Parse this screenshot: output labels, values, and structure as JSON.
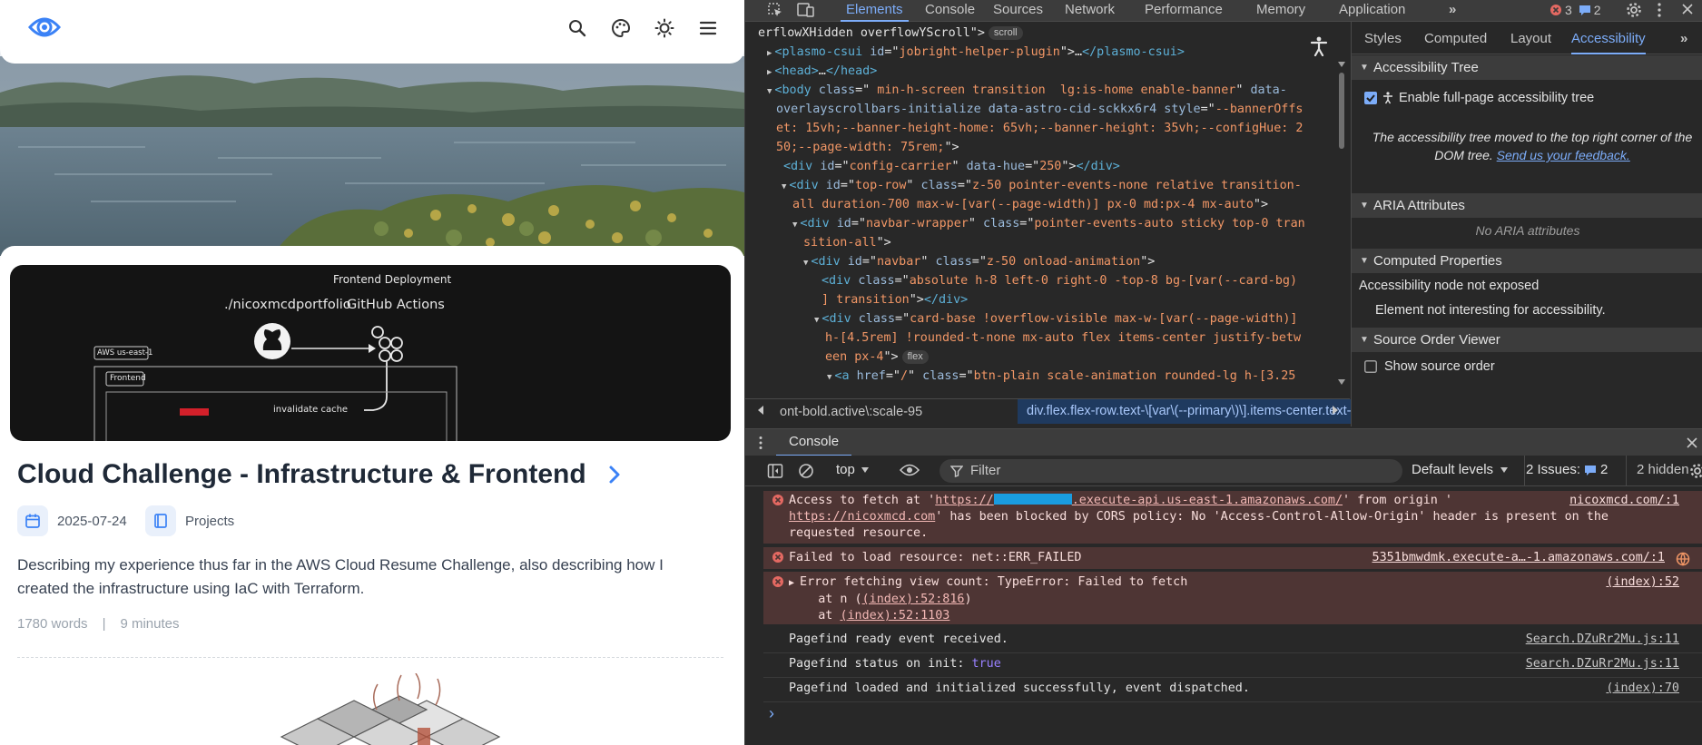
{
  "site": {
    "nav_icons": [
      "eye-logo-icon",
      "search-icon",
      "palette-icon",
      "sun-icon",
      "menu-icon"
    ],
    "cover": {
      "heading": "Frontend Deployment",
      "repo": "./nicoxmcdportfolio",
      "actions": "GitHub Actions",
      "region": "AWS us-east-1",
      "frontend": "Frontend",
      "invalidate": "invalidate cache"
    },
    "post": {
      "title": "Cloud Challenge - Infrastructure & Frontend",
      "date": "2025-07-24",
      "category": "Projects",
      "description": "Describing my experience thus far in the AWS Cloud Resume Challenge, also describing how I created the infrastructure using IaC with Terraform.",
      "words": "1780 words",
      "separator": "|",
      "reading_time": "9 minutes"
    },
    "colors": {
      "accent": "#3b82f6",
      "title": "#1f2937",
      "card_bg": "#ffffff",
      "meta_icon_bg": "#e9f0fb"
    }
  },
  "devtools": {
    "main_tabs": [
      "Elements",
      "Console",
      "Sources",
      "Network",
      "Performance",
      "Memory",
      "Application"
    ],
    "active_tab": "Elements",
    "more_tabs": "»",
    "error_count": "3",
    "issue_count": "2",
    "dom_lines": [
      {
        "parts": [
          [
            "tx",
            "erflowXHidden overflowYScroll\">"
          ]
        ],
        "pill": "scroll"
      },
      {
        "parts": [
          [
            "tg",
            "<plasmo-csui "
          ],
          [
            "at",
            "id"
          ],
          [
            "tx",
            "=\""
          ],
          [
            "av",
            "jobright-helper-plugin"
          ],
          [
            "tx",
            "\">"
          ],
          [
            "tx",
            "…"
          ],
          [
            "tg",
            "</plasmo-csui>"
          ]
        ]
      },
      {
        "parts": [
          [
            "tg",
            "<head>"
          ],
          [
            "tx",
            "…"
          ],
          [
            "tg",
            "</head>"
          ]
        ]
      },
      {
        "parts": [
          [
            "tg",
            "<body "
          ],
          [
            "at",
            "class"
          ],
          [
            "tx",
            "=\""
          ],
          [
            "av",
            " min-h-screen transition  lg:is-home enable-banner"
          ],
          [
            "tx",
            "\" "
          ],
          [
            "at",
            "data-"
          ]
        ]
      },
      {
        "parts": [
          [
            "at",
            "overlayscrollbars-initialize data-astro-cid-sckkx6r4 "
          ],
          [
            "at",
            "style"
          ],
          [
            "tx",
            "=\""
          ],
          [
            "av",
            "--bannerOffs"
          ]
        ]
      },
      {
        "parts": [
          [
            "av",
            "et: 15vh;--banner-height-home: 65vh;--banner-height: 35vh;--configHue: 2"
          ]
        ]
      },
      {
        "parts": [
          [
            "av",
            "50;--page-width: 75rem;"
          ],
          [
            "tx",
            "\">"
          ]
        ]
      },
      {
        "parts": [
          [
            "tg",
            "<div "
          ],
          [
            "at",
            "id"
          ],
          [
            "tx",
            "=\""
          ],
          [
            "av",
            "config-carrier"
          ],
          [
            "tx",
            "\" "
          ],
          [
            "at",
            "data-hue"
          ],
          [
            "tx",
            "=\""
          ],
          [
            "av",
            "250"
          ],
          [
            "tx",
            "\">"
          ],
          [
            "tg",
            "</div>"
          ]
        ]
      },
      {
        "parts": [
          [
            "tg",
            "<div "
          ],
          [
            "at",
            "id"
          ],
          [
            "tx",
            "=\""
          ],
          [
            "av",
            "top-row"
          ],
          [
            "tx",
            "\" "
          ],
          [
            "at",
            "class"
          ],
          [
            "tx",
            "=\""
          ],
          [
            "av",
            "z-50 pointer-events-none relative transition-"
          ]
        ]
      },
      {
        "parts": [
          [
            "av",
            "all duration-700 max-w-[var(--page-width)] px-0 md:px-4 mx-auto"
          ],
          [
            "tx",
            "\">"
          ]
        ]
      },
      {
        "parts": [
          [
            "tg",
            "<div "
          ],
          [
            "at",
            "id"
          ],
          [
            "tx",
            "=\""
          ],
          [
            "av",
            "navbar-wrapper"
          ],
          [
            "tx",
            "\" "
          ],
          [
            "at",
            "class"
          ],
          [
            "tx",
            "=\""
          ],
          [
            "av",
            "pointer-events-auto sticky top-0 tran"
          ]
        ]
      },
      {
        "parts": [
          [
            "av",
            "sition-all"
          ],
          [
            "tx",
            "\">"
          ]
        ]
      },
      {
        "parts": [
          [
            "tg",
            "<div "
          ],
          [
            "at",
            "id"
          ],
          [
            "tx",
            "=\""
          ],
          [
            "av",
            "navbar"
          ],
          [
            "tx",
            "\" "
          ],
          [
            "at",
            "class"
          ],
          [
            "tx",
            "=\""
          ],
          [
            "av",
            "z-50 onload-animation"
          ],
          [
            "tx",
            "\">"
          ]
        ]
      },
      {
        "parts": [
          [
            "tg",
            "<div "
          ],
          [
            "at",
            "class"
          ],
          [
            "tx",
            "=\""
          ],
          [
            "av",
            "absolute h-8 left-0 right-0 -top-8 bg-[var(--card-bg)"
          ]
        ]
      },
      {
        "parts": [
          [
            "av",
            "] transition"
          ],
          [
            "tx",
            "\">"
          ],
          [
            "tg",
            "</div>"
          ]
        ]
      },
      {
        "parts": [
          [
            "tg",
            "<div "
          ],
          [
            "at",
            "class"
          ],
          [
            "tx",
            "=\""
          ],
          [
            "av",
            "card-base !overflow-visible max-w-[var(--page-width)]"
          ]
        ]
      },
      {
        "parts": [
          [
            "av",
            "h-[4.5rem] !rounded-t-none mx-auto flex items-center justify-betw"
          ]
        ]
      },
      {
        "parts": [
          [
            "av",
            "een px-4"
          ],
          [
            "tx",
            "\">"
          ]
        ],
        "pill": "flex"
      },
      {
        "parts": [
          [
            "tg",
            "<a "
          ],
          [
            "at",
            "href"
          ],
          [
            "tx",
            "=\""
          ],
          [
            "av",
            "/"
          ],
          [
            "tx",
            "\" "
          ],
          [
            "at",
            "class"
          ],
          [
            "tx",
            "=\""
          ],
          [
            "av",
            "btn-plain scale-animation rounded-lg h-[3.25"
          ]
        ]
      }
    ],
    "breadcrumb_left": "ont-bold.active\\:scale-95",
    "breadcrumb_right": "div.flex.flex-row.text-\\[var\\(--primary\\)\\].items-center.text-md",
    "side_tabs": [
      "Styles",
      "Computed",
      "Layout",
      "Accessibility"
    ],
    "side_active": "Accessibility",
    "accessibility": {
      "tree_head": "Accessibility Tree",
      "enable_label": "Enable full-page accessibility tree",
      "tree_note": "The accessibility tree moved to the top right corner of the DOM tree.",
      "feedback_link": "Send us your feedback.",
      "aria_head": "ARIA Attributes",
      "no_aria": "No ARIA attributes",
      "computed_head": "Computed Properties",
      "not_exposed": "Accessibility node not exposed",
      "not_interesting": "Element not interesting for accessibility.",
      "source_head": "Source Order Viewer",
      "show_source": "Show source order"
    },
    "console": {
      "tab": "Console",
      "context": "top",
      "filter_placeholder": "Filter",
      "levels": "Default levels",
      "issues_label": "2 Issues:",
      "issues_count": "2",
      "hidden": "2 hidden",
      "messages": [
        {
          "type": "error",
          "l1_a": "Access to fetch at '",
          "l1_link": "https://",
          "l1_link2": ".execute-api.us-east-1.amazonaws.com/",
          "l1_b": "' from origin '",
          "l2_link": "https://nicoxmcd.com",
          "l2_b": "' has been blocked by CORS policy: No 'Access-Control-Allow-Origin' header is present on the",
          "l3": "requested resource.",
          "source": "nicoxmcd.com/:1"
        },
        {
          "type": "error",
          "l1_a": "Failed to load resource: net::ERR_FAILED",
          "source": "5351bmwdmk.execute-a…-1.amazonaws.com/:1"
        },
        {
          "type": "error",
          "l1_a": "Error fetching view count: TypeError: Failed to fetch",
          "l2_a": "    at n (",
          "l2_link": "(index):52:816",
          "l2_b": ")",
          "l3_a": "    at ",
          "l3_link": "(index):52:1103",
          "source": "(index):52"
        },
        {
          "type": "log",
          "text": "Pagefind ready event received.",
          "source": "Search.DZuRr2Mu.js:11"
        },
        {
          "type": "log",
          "text": "Pagefind status on init: ",
          "value": "true",
          "source": "Search.DZuRr2Mu.js:11"
        },
        {
          "type": "log",
          "text": "Pagefind loaded and initialized successfully, event dispatched.",
          "source": "(index):70"
        }
      ],
      "prompt": "›"
    }
  }
}
